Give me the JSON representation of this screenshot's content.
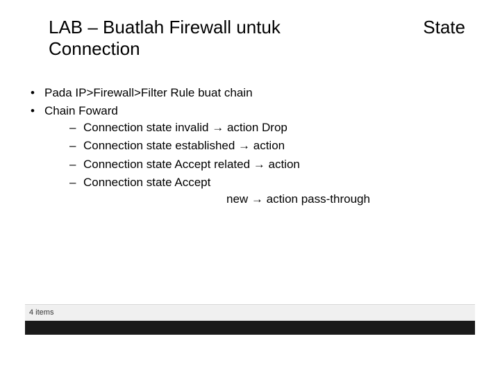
{
  "title": {
    "left": "LAB – Buatlah Firewall untuk Connection",
    "right": "State"
  },
  "bullets": {
    "b1": "Pada IP>Firewall>Filter Rule buat chain",
    "b2": "Chain Foward",
    "sub": {
      "s1": "Connection state invalid → action Drop",
      "s2": "Connection state established → action",
      "s3": "Connection state Accept related → action",
      "s4": "Connection state Accept",
      "s4_cont": "new → action pass-through"
    }
  },
  "status": "4 items"
}
